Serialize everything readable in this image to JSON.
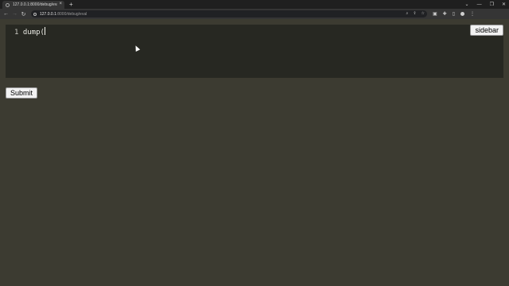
{
  "browser": {
    "tab_title": "127.0.0.1:8000/debug/eval",
    "tab_close": "×",
    "new_tab": "+",
    "url_host": "127.0.0.1",
    "url_path": ":8000/debug/eval",
    "window_controls": [
      "⌄",
      "—",
      "❐",
      "✕"
    ],
    "nav": {
      "back": "←",
      "forward": "→",
      "reload": "↻"
    }
  },
  "editor": {
    "line_number": "1",
    "code": "dump("
  },
  "sidebar_button": "sidebar",
  "submit_button": "Submit"
}
